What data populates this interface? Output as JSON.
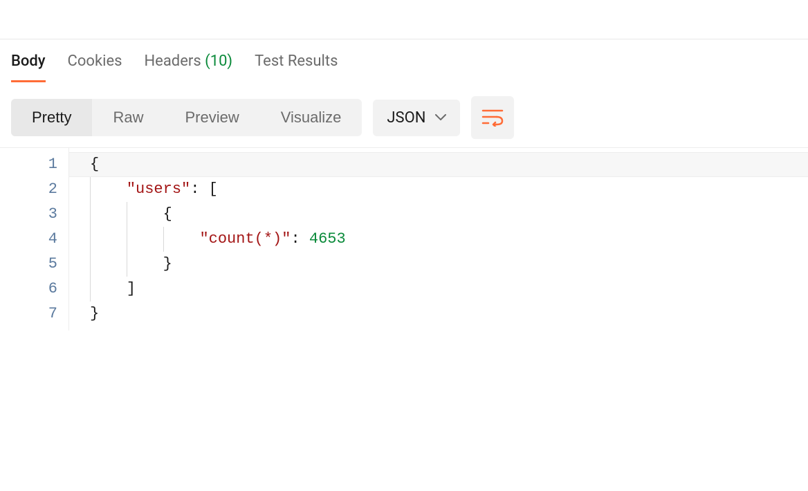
{
  "tabs": {
    "body": "Body",
    "cookies": "Cookies",
    "headers_label": "Headers",
    "headers_count": "(10)",
    "test_results": "Test Results"
  },
  "view_modes": {
    "pretty": "Pretty",
    "raw": "Raw",
    "preview": "Preview",
    "visualize": "Visualize"
  },
  "format_select": {
    "value": "JSON"
  },
  "code": {
    "line_numbers": [
      "1",
      "2",
      "3",
      "4",
      "5",
      "6",
      "7"
    ],
    "json_tokens": {
      "open_brace": "{",
      "users_key": "\"users\"",
      "colon_space": ": ",
      "open_bracket": "[",
      "count_key": "\"count(*)\"",
      "count_val": "4653",
      "close_brace": "}",
      "close_bracket": "]"
    }
  }
}
